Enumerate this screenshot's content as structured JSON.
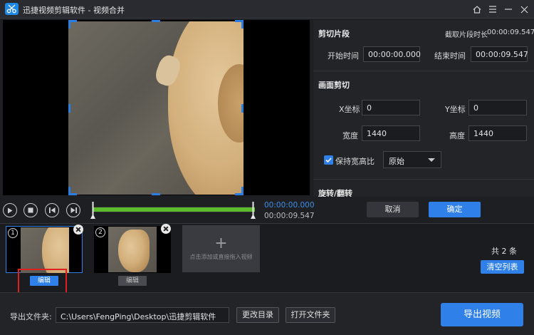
{
  "app": {
    "title": "迅捷视频剪辑软件 - 视频合并"
  },
  "colors": {
    "accent": "#2f80e8",
    "timeline": "#5bbb2c",
    "highlight": "#e02020"
  },
  "player": {
    "current_time": "00:00:00.000",
    "total_time": "00:00:09.547",
    "progress": 0
  },
  "clip_section": {
    "title": "剪切片段",
    "duration_label": "截取片段时长",
    "duration_value": "00:00:09.547",
    "start_label": "开始时间",
    "start_value": "00:00:00.000",
    "end_label": "结束时间",
    "end_value": "00:00:09.547"
  },
  "crop_section": {
    "title": "画面剪切",
    "x_label": "X坐标",
    "x_value": "0",
    "y_label": "Y坐标",
    "y_value": "0",
    "width_label": "宽度",
    "width_value": "1440",
    "height_label": "高度",
    "height_value": "1440",
    "keep_ratio_label": "保持宽高比",
    "keep_ratio_checked": true,
    "ratio_select_value": "原始"
  },
  "rotate_section": {
    "title": "旋转/翻转"
  },
  "panel_buttons": {
    "cancel": "取消",
    "ok": "确定"
  },
  "clips": [
    {
      "number": "1",
      "edit_label": "编辑",
      "selected": true
    },
    {
      "number": "2",
      "edit_label": "编辑",
      "selected": false
    }
  ],
  "add_clip": {
    "plus": "+",
    "text": "点击添加或直接拖入视频"
  },
  "list": {
    "count_text": "共 2 条",
    "clear_label": "清空列表"
  },
  "bottom": {
    "export_folder_label": "导出文件夹:",
    "export_path": "C:\\Users\\FengPing\\Desktop\\迅捷剪辑软件",
    "change_dir_label": "更改目录",
    "open_folder_label": "打开文件夹",
    "export_video_label": "导出视频"
  },
  "icons": {
    "logo": "scissors-icon",
    "home": "home-icon",
    "menu": "menu-icon",
    "minimize": "minimize-icon",
    "close": "close-icon",
    "play": "play-icon",
    "stop": "stop-icon",
    "prev_frame": "prev-frame-icon",
    "next_frame": "next-frame-icon"
  }
}
